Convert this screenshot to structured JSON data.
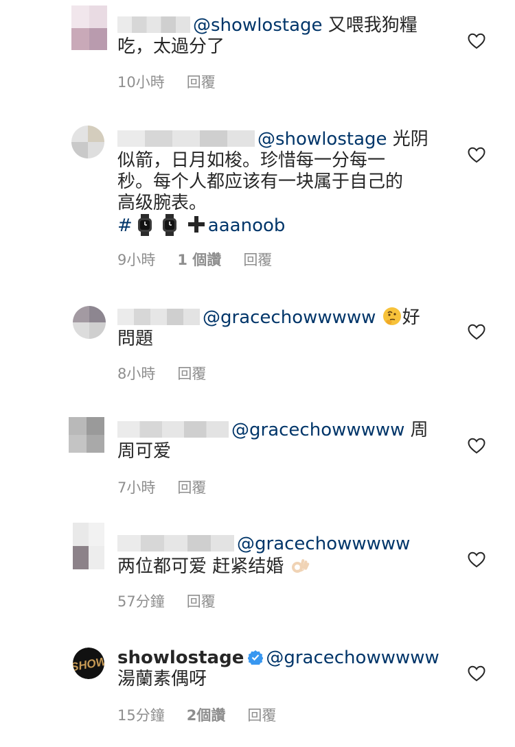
{
  "comments": [
    {
      "mention": "@showlostage",
      "text_line1": " 又喂我狗糧",
      "text_line2": "吃，太過分了",
      "time": "10小時",
      "reply": "回覆"
    },
    {
      "mention": "@showlostage",
      "text_line1": " 光阴",
      "text_line2": "似箭，日月如梭。珍惜每一分每一",
      "text_line3": "秒。每个人都应该有一块属于自己的",
      "text_line4": "高级腕表。",
      "hash": "#",
      "tag_text": "aaanoob",
      "time": "9小時",
      "likes": "1 個讚",
      "reply": "回覆"
    },
    {
      "mention": "@gracechowwwww",
      "text_line1_after_emoji": "好",
      "text_line2": "問題",
      "time": "8小時",
      "reply": "回覆"
    },
    {
      "mention": "@gracechowwwww",
      "text_line1": " 周",
      "text_line2": "周可爱",
      "time": "7小時",
      "reply": "回覆"
    },
    {
      "mention": "@gracechowwwww",
      "text_line2": "两位都可爱 赶紧结婚",
      "time": "57分鐘",
      "reply": "回覆"
    },
    {
      "username": "showlostage",
      "mention": "@gracechowwwww",
      "text_line2": "湯蘭素偶呀",
      "time": "15分鐘",
      "likes": "2個讚",
      "reply": "回覆"
    }
  ],
  "icons": {
    "heart": "heart-outline-icon",
    "verified": "verified-badge-icon",
    "thinking": "thinking-face-emoji",
    "ok_hand": "ok-hand-emoji",
    "watch": "watch-emoji",
    "plus": "heavy-plus-sign-emoji"
  },
  "colors": {
    "mention": "#003569",
    "meta": "#8e8e8e",
    "verified": "#3897f0"
  }
}
